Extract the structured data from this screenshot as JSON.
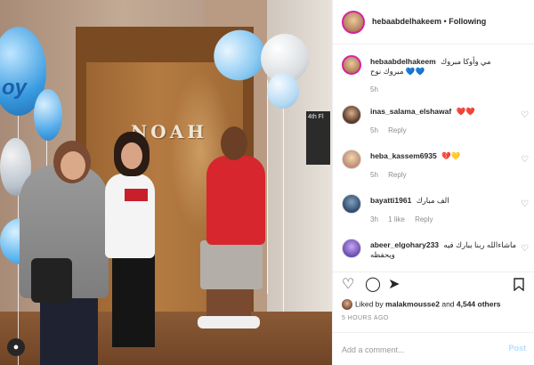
{
  "photo": {
    "door_sign": "NOAH",
    "room_sign": "4th Fl",
    "balloon_text": "oy"
  },
  "header": {
    "username": "hebaabdelhakeem",
    "separator": " • ",
    "follow_status": "Following"
  },
  "caption": {
    "username": "hebaabdelhakeem",
    "line1": "مي وأوكا مبروك",
    "line2": "مبروك نوح",
    "emoji": "💙💙",
    "time": "5h"
  },
  "comments": [
    {
      "username": "inas_salama_elshawaf",
      "text": "",
      "emoji": "❤️❤️",
      "time": "5h",
      "reply": "Reply",
      "likes": ""
    },
    {
      "username": "heba_kassem6935",
      "text": "",
      "emoji": "💔💛",
      "time": "5h",
      "reply": "Reply",
      "likes": ""
    },
    {
      "username": "bayatti1961",
      "text": "الف مبارك",
      "emoji": "",
      "time": "3h",
      "reply": "Reply",
      "likes": "1 like"
    },
    {
      "username": "abeer_elgohary233",
      "text": "ماشاءالله ربنا يبارك فيه ويحفظه",
      "emoji": "",
      "time": "",
      "reply": "",
      "likes": ""
    }
  ],
  "likes": {
    "prefix": "Liked by ",
    "first_user": "malakmousse2",
    "middle": " and ",
    "others": "4,544 others"
  },
  "time_ago": "5 HOURS AGO",
  "add_comment": {
    "placeholder": "Add a comment...",
    "post_label": "Post"
  },
  "icons": {
    "like": "heart-outline-icon",
    "comment": "comment-bubble-icon",
    "share": "paper-plane-icon",
    "save": "bookmark-icon"
  },
  "colors": {
    "link_blue": "#b2dffc",
    "text": "#262626",
    "muted": "#8e8e8e",
    "story_ring": "#d6249f"
  }
}
